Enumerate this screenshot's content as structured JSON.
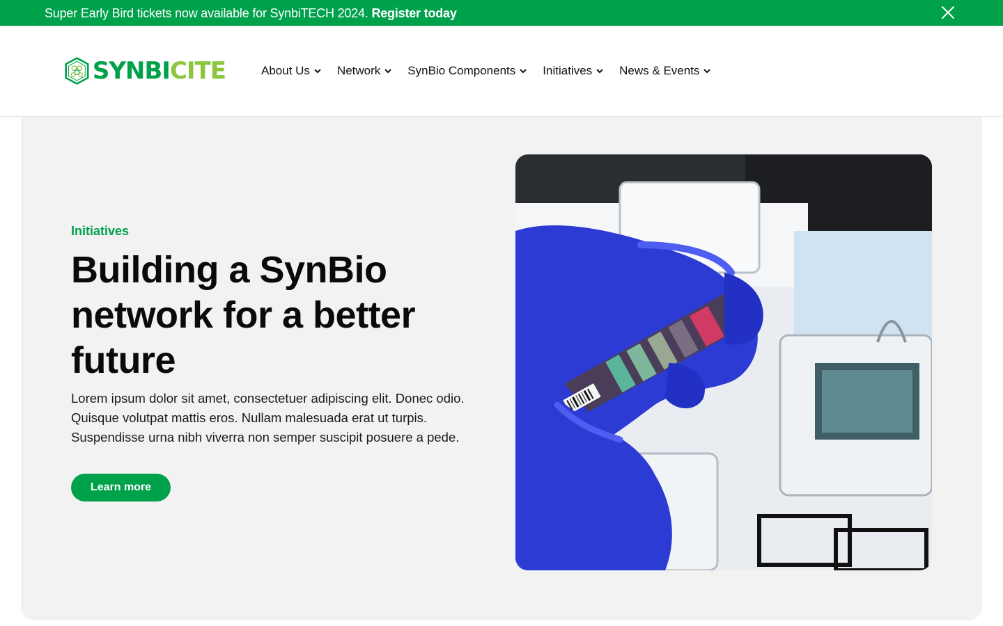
{
  "announcement": {
    "text": "Super Early Bird tickets now available for SynbiTECH 2024.",
    "link_label": "Register today",
    "close_icon": "close-icon"
  },
  "brand": {
    "name_part1": "SYNBI",
    "name_part2": "CITE",
    "primary_color": "#00a14b",
    "secondary_color": "#8cc63f"
  },
  "nav": {
    "items": [
      {
        "label": "About Us"
      },
      {
        "label": "Network"
      },
      {
        "label": "SynBio Components"
      },
      {
        "label": "Initiatives"
      },
      {
        "label": "News & Events"
      }
    ]
  },
  "hero": {
    "eyebrow": "Initiatives",
    "title": "Building a SynBio network for a better future",
    "body": "Lorem ipsum dolor sit amet, consectetuer adipiscing elit. Donec odio. Quisque volutpat mattis eros. Nullam malesuada erat ut turpis. Suspendisse urna nibh viverra non semper suscipit posuere a pede.",
    "cta_label": "Learn more",
    "background_color": "#f2f2f2"
  }
}
